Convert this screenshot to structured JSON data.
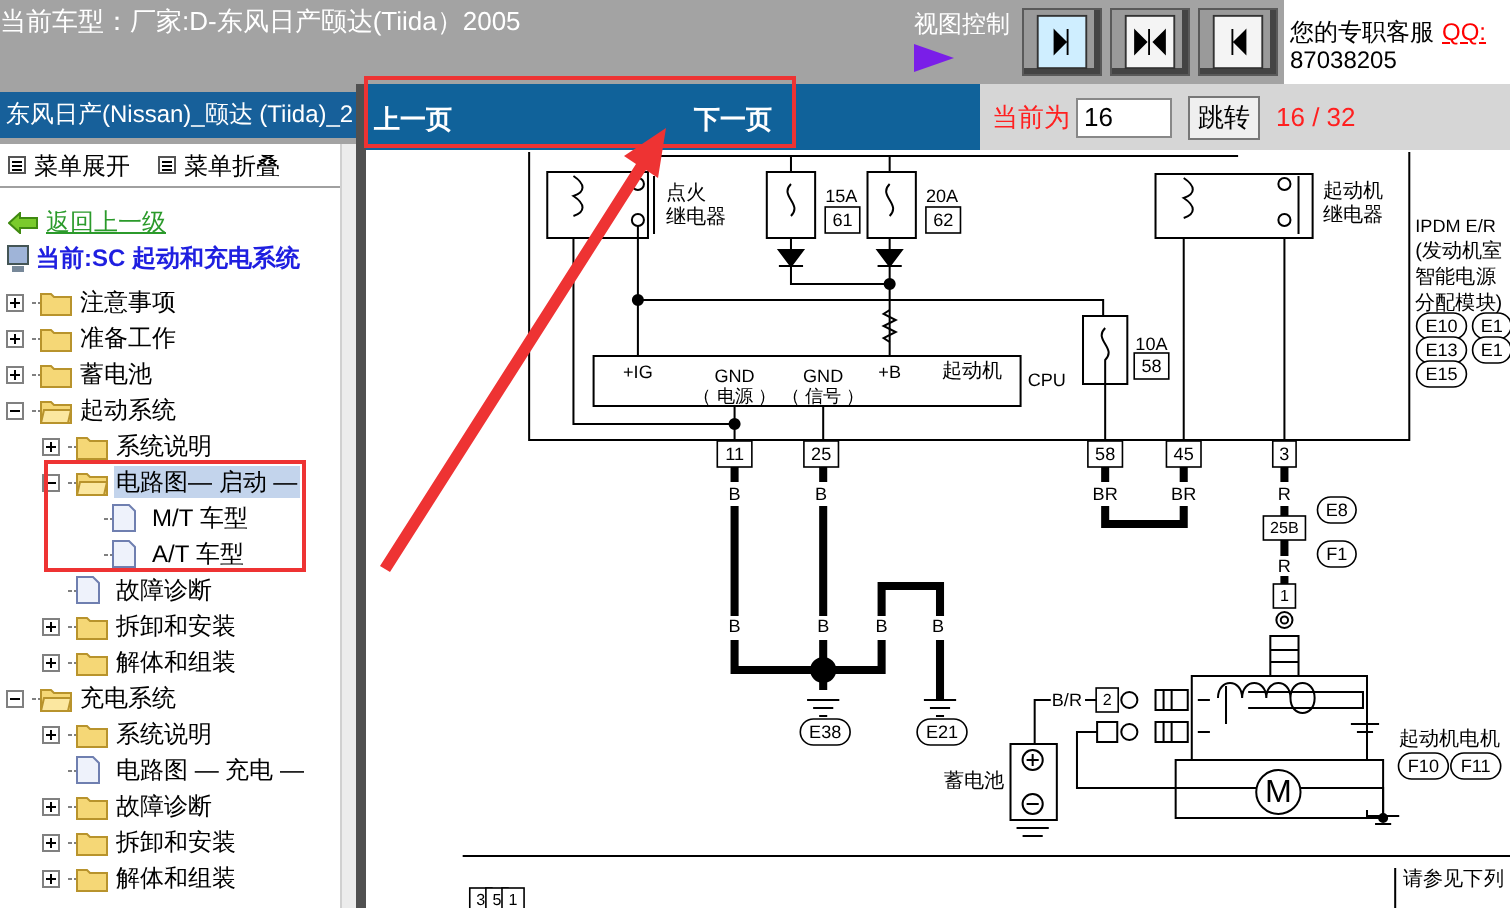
{
  "header": {
    "title": "当前车型：厂家:D-东风日产颐达(Tiida）2005",
    "view_control_label": "视图控制",
    "service_label": "您的专职客服",
    "qq_link": "QQ:",
    "phone": "87038205"
  },
  "sidebar": {
    "title": "东风日产(Nissan)_颐达 (Tiida)_2",
    "expand_all": "菜单展开",
    "collapse_all": "菜单折叠",
    "back": "返回上一级",
    "current": "当前:SC 起动和充电系统",
    "tree": [
      {
        "label": "注意事项",
        "kind": "folder",
        "expanded": false,
        "selected": false
      },
      {
        "label": "准备工作",
        "kind": "folder",
        "expanded": false,
        "selected": false
      },
      {
        "label": "蓄电池",
        "kind": "folder",
        "expanded": false,
        "selected": false
      },
      {
        "label": "起动系统",
        "kind": "folder",
        "expanded": true,
        "selected": false,
        "children": [
          {
            "label": "系统说明",
            "kind": "folder",
            "expanded": false,
            "selected": false
          },
          {
            "label": "电路图— 启动 —",
            "kind": "folder",
            "expanded": true,
            "selected": true,
            "children": [
              {
                "label": "M/T 车型",
                "kind": "page",
                "selected": false
              },
              {
                "label": "A/T 车型",
                "kind": "page",
                "selected": false
              }
            ]
          },
          {
            "label": "故障诊断",
            "kind": "page",
            "selected": false
          },
          {
            "label": "拆卸和安装",
            "kind": "folder",
            "expanded": false,
            "selected": false
          },
          {
            "label": "解体和组装",
            "kind": "folder",
            "expanded": false,
            "selected": false
          }
        ]
      },
      {
        "label": "充电系统",
        "kind": "folder",
        "expanded": true,
        "selected": false,
        "children": [
          {
            "label": "系统说明",
            "kind": "folder",
            "expanded": false,
            "selected": false
          },
          {
            "label": "电路图 — 充电 —",
            "kind": "page",
            "selected": false
          },
          {
            "label": "故障诊断",
            "kind": "folder",
            "expanded": false,
            "selected": false
          },
          {
            "label": "拆卸和安装",
            "kind": "folder",
            "expanded": false,
            "selected": false
          },
          {
            "label": "解体和组装",
            "kind": "folder",
            "expanded": false,
            "selected": false
          }
        ]
      }
    ]
  },
  "pager": {
    "prev": "上一页",
    "next": "下一页",
    "current_label": "当前为",
    "page_input": "16",
    "jump": "跳转",
    "page_count": "16 / 32"
  },
  "diagram": {
    "labels": [
      {
        "text": "点火",
        "kind": "plain"
      },
      {
        "text": "继电器",
        "kind": "plain"
      },
      {
        "text": "15A",
        "kind": "plain"
      },
      {
        "text": "61",
        "kind": "box"
      },
      {
        "text": "20A",
        "kind": "plain"
      },
      {
        "text": "62",
        "kind": "box"
      },
      {
        "text": "+IG",
        "kind": "plain"
      },
      {
        "text": "GND",
        "kind": "plain"
      },
      {
        "text": "（ 电源 ）",
        "kind": "plain"
      },
      {
        "text": "GND",
        "kind": "plain"
      },
      {
        "text": "（ 信号 ）",
        "kind": "plain"
      },
      {
        "text": "+B",
        "kind": "plain"
      },
      {
        "text": "起动机",
        "kind": "plain"
      },
      {
        "text": "CPU",
        "kind": "plain"
      },
      {
        "text": "10A",
        "kind": "plain"
      },
      {
        "text": "58",
        "kind": "box"
      },
      {
        "text": "起动机",
        "kind": "plain"
      },
      {
        "text": "继电器",
        "kind": "plain"
      },
      {
        "text": "IPDM E/R",
        "kind": "plain"
      },
      {
        "text": "(发动机室",
        "kind": "plain"
      },
      {
        "text": "智能电源",
        "kind": "plain"
      },
      {
        "text": "分配模块)",
        "kind": "plain"
      },
      {
        "text": "E10",
        "kind": "oval"
      },
      {
        "text": "E1",
        "kind": "oval"
      },
      {
        "text": "E13",
        "kind": "oval"
      },
      {
        "text": "E1",
        "kind": "oval"
      },
      {
        "text": "E15",
        "kind": "oval"
      },
      {
        "text": "11",
        "kind": "box"
      },
      {
        "text": "25",
        "kind": "box"
      },
      {
        "text": "58",
        "kind": "box"
      },
      {
        "text": "45",
        "kind": "box"
      },
      {
        "text": "3",
        "kind": "box"
      },
      {
        "text": "B",
        "kind": "plain"
      },
      {
        "text": "B",
        "kind": "plain"
      },
      {
        "text": "BR",
        "kind": "plain"
      },
      {
        "text": "BR",
        "kind": "plain"
      },
      {
        "text": "R",
        "kind": "plain"
      },
      {
        "text": "E8",
        "kind": "oval"
      },
      {
        "text": "25B",
        "kind": "box"
      },
      {
        "text": "F1",
        "kind": "oval"
      },
      {
        "text": "R",
        "kind": "plain"
      },
      {
        "text": "1",
        "kind": "box"
      },
      {
        "text": "B",
        "kind": "plain"
      },
      {
        "text": "B",
        "kind": "plain"
      },
      {
        "text": "B",
        "kind": "plain"
      },
      {
        "text": "B",
        "kind": "plain"
      },
      {
        "text": "E38",
        "kind": "oval"
      },
      {
        "text": "E21",
        "kind": "oval"
      },
      {
        "text": "B/R",
        "kind": "plain"
      },
      {
        "text": "2",
        "kind": "box"
      },
      {
        "text": "蓄电池",
        "kind": "plain"
      },
      {
        "text": "起动机电机",
        "kind": "plain"
      },
      {
        "text": "F10",
        "kind": "oval"
      },
      {
        "text": "F11",
        "kind": "oval"
      },
      {
        "text": "M",
        "kind": "plain"
      },
      {
        "text": "请参见下列",
        "kind": "plain"
      },
      {
        "text": "3",
        "kind": "box"
      },
      {
        "text": "5",
        "kind": "box"
      },
      {
        "text": "1",
        "kind": "box"
      }
    ]
  }
}
